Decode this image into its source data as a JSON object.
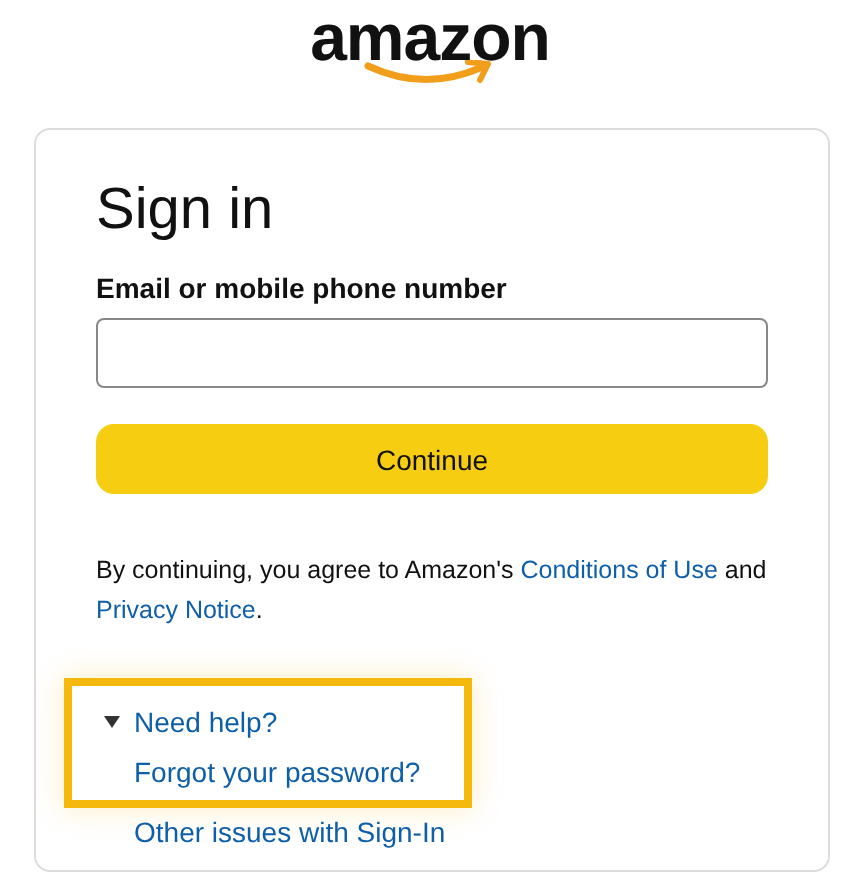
{
  "logo": {
    "text": "amazon"
  },
  "card": {
    "title": "Sign in",
    "email_field": {
      "label": "Email or mobile phone number"
    },
    "continue_button": {
      "label": "Continue"
    },
    "legal": [
      {
        "kind": "text",
        "text": "By continuing, you agree to Amazon's "
      },
      {
        "kind": "link",
        "text": "Conditions of Use"
      },
      {
        "kind": "text",
        "text": " and "
      },
      {
        "kind": "link",
        "text": "Privacy Notice"
      },
      {
        "kind": "text",
        "text": "."
      }
    ],
    "help": {
      "label": "Need help?",
      "expanded": true,
      "highlighted": true,
      "links": [
        {
          "text": "Forgot your password?",
          "highlighted": true
        },
        {
          "text": "Other issues with Sign-In",
          "highlighted": false
        }
      ]
    }
  }
}
